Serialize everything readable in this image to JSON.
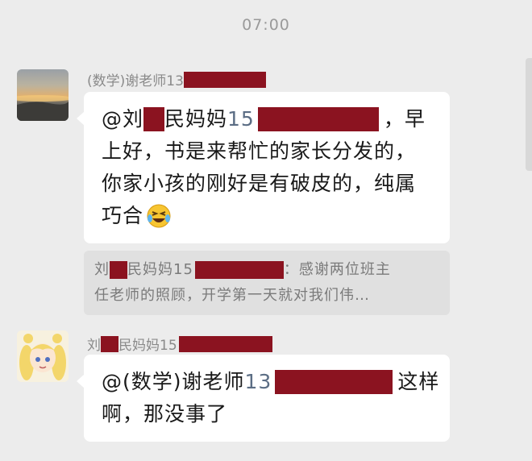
{
  "timestamp": "07:00",
  "messages": [
    {
      "sender": "(数学)谢老师13",
      "avatar": "sunset-photo",
      "mention_prefix": "@刘",
      "mention_mid": "民妈妈",
      "mention_num": "15",
      "line1_tail": "，早",
      "line2": "上好，书是来帮忙的家长分发的，",
      "line3": "你家小孩的刚好是有破皮的，纯属",
      "line4": "巧合",
      "emoji": "laughing-tears-emoji"
    },
    {
      "quote_name_a": "刘",
      "quote_name_b": "民妈妈15",
      "quote_colon": "：感谢两位班主",
      "quote_line2": "任老师的照顾，开学第一天就对我们伟…"
    },
    {
      "sender_a": "刘",
      "sender_b": "民妈妈15",
      "avatar": "anime-girl",
      "mention_prefix": "@(数学)谢老师",
      "mention_num": "13",
      "line1_tail": "这样",
      "line2": "啊，那没事了"
    }
  ],
  "colors": {
    "background": "#ececec",
    "bubble": "#ffffff",
    "redaction": "#8b1320",
    "mention_number": "#5b6d84"
  }
}
